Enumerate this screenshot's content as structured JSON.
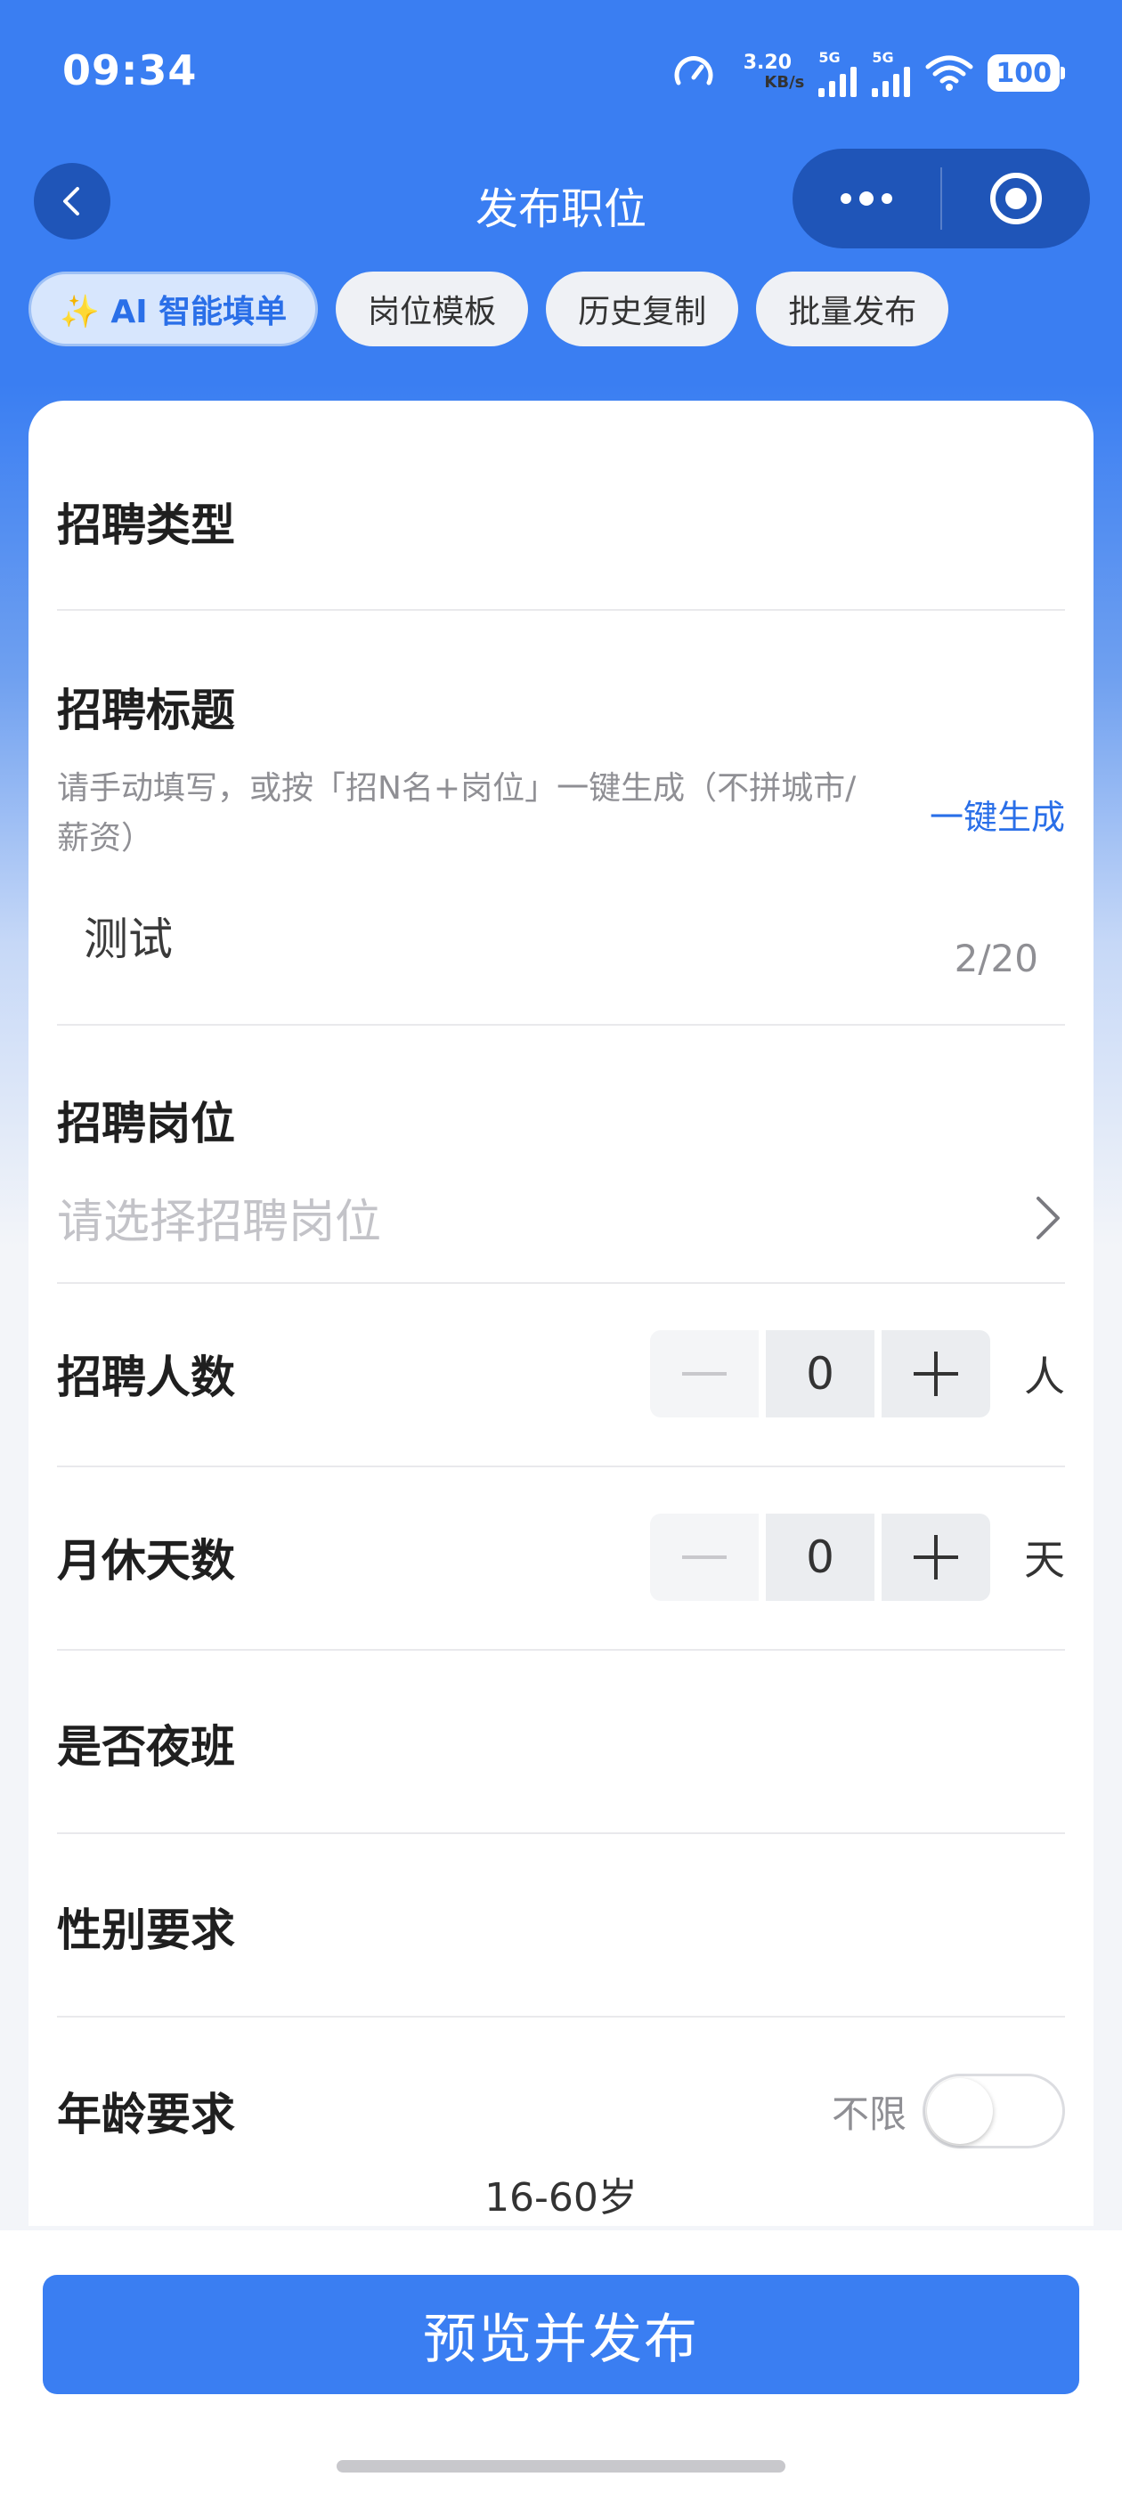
{
  "status_bar": {
    "time": "09:34",
    "net_speed_value": "3.20",
    "net_speed_unit": "KB/s",
    "signal_1_tag": "5G",
    "signal_2_tag": "5G",
    "battery": "100"
  },
  "nav": {
    "title": "发布职位"
  },
  "tabs": [
    {
      "label": "✨ AI 智能填单"
    },
    {
      "label": "岗位模板"
    },
    {
      "label": "历史复制"
    },
    {
      "label": "批量发布"
    }
  ],
  "form": {
    "recruit_type": {
      "label": "招聘类型"
    },
    "recruit_title": {
      "label": "招聘标题",
      "hint": "请手动填写，或按「招N名+岗位」一键生成（不拼城市/薪资）",
      "generate_link": "一键生成",
      "value": "测试",
      "counter": "2/20"
    },
    "recruit_position": {
      "label": "招聘岗位",
      "placeholder": "请选择招聘岗位"
    },
    "recruit_count": {
      "label": "招聘人数",
      "value": "0",
      "unit": "人"
    },
    "rest_days": {
      "label": "月休天数",
      "value": "0",
      "unit": "天"
    },
    "night_shift": {
      "label": "是否夜班"
    },
    "gender": {
      "label": "性别要求"
    },
    "age": {
      "label": "年龄要求",
      "toggle_label": "不限",
      "toggle_on": false,
      "range": "16-60岁"
    }
  },
  "footer": {
    "publish_label": "预览并发布"
  },
  "colors": {
    "brand_blue": "#3a7ef2",
    "link_blue": "#2a6fe8",
    "dark_blue": "#1f55b8"
  }
}
